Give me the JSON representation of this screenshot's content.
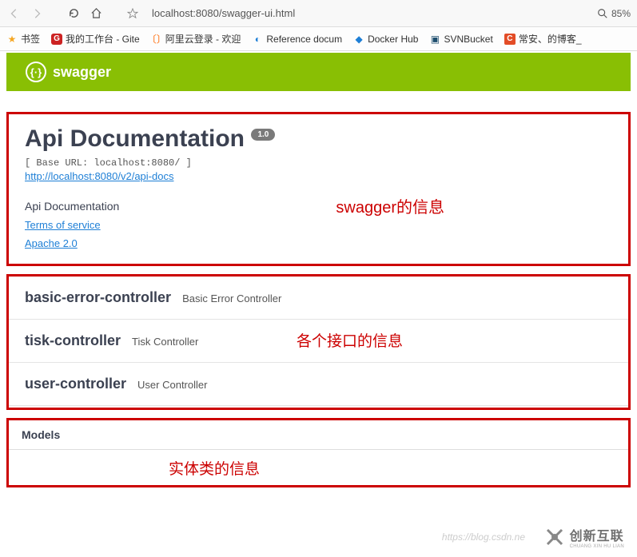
{
  "browser": {
    "url": "localhost:8080/swagger-ui.html",
    "zoom": "85%"
  },
  "bookmarks": [
    {
      "label": "书签"
    },
    {
      "label": "我的工作台 - Gite"
    },
    {
      "label": "阿里云登录 - 欢迎"
    },
    {
      "label": "Reference docum"
    },
    {
      "label": "Docker Hub"
    },
    {
      "label": "SVNBucket"
    },
    {
      "label": "常安、的博客_"
    }
  ],
  "swagger": {
    "brand": "swagger"
  },
  "info": {
    "title": "Api Documentation",
    "version": "1.0",
    "base_url_line": "[ Base URL: localhost:8080/ ]",
    "api_docs_link": "http://localhost:8080/v2/api-docs",
    "description": "Api Documentation",
    "tos": "Terms of service",
    "license": "Apache 2.0",
    "annotation": "swagger的信息"
  },
  "controllers": {
    "items": [
      {
        "name": "basic-error-controller",
        "desc": "Basic Error Controller"
      },
      {
        "name": "tisk-controller",
        "desc": "Tisk Controller"
      },
      {
        "name": "user-controller",
        "desc": "User Controller"
      }
    ],
    "annotation": "各个接口的信息"
  },
  "models": {
    "title": "Models",
    "annotation": "实体类的信息"
  },
  "watermark": {
    "url": "https://blog.csdn.ne",
    "logo_cn": "创新互联",
    "logo_en": "CHUANG XIN HU LIAN"
  }
}
